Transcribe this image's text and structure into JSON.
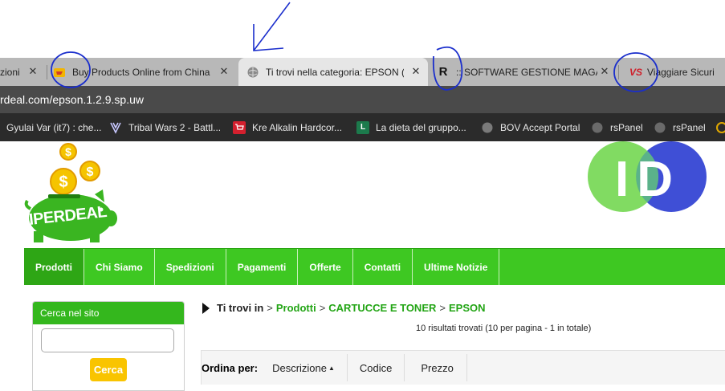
{
  "browser": {
    "tabs": [
      {
        "title": "zioni",
        "favicon": "none"
      },
      {
        "title": "Buy Products Online from China",
        "favicon": "shopping-icon"
      },
      {
        "title": "Ti trovi nella categoria: EPSON (P",
        "favicon": "globe-icon"
      },
      {
        "title": ":: SOFTWARE GESTIONE MAGAZZ",
        "favicon": "r-logo-icon",
        "favicon_text": "R"
      },
      {
        "title": "Viaggiare Sicuri",
        "favicon": "vs-logo-icon",
        "favicon_text": "VS"
      }
    ],
    "url": "rdeal.com/epson.1.2.9.sp.uw",
    "bookmarks": [
      {
        "label": "Gyulai Var (it7) : che...",
        "icon": "none"
      },
      {
        "label": "Tribal Wars 2 - Battl...",
        "icon": "tribal-wars-icon"
      },
      {
        "label": "Kre Alkalin Hardcor...",
        "icon": "cart-icon"
      },
      {
        "label": "La dieta del gruppo...",
        "icon": "l-logo-icon",
        "icon_text": "L"
      },
      {
        "label": "BOV Accept Portal",
        "icon": "globe-icon"
      },
      {
        "label": "rsPanel",
        "icon": "globe-icon"
      },
      {
        "label": "rsPanel",
        "icon": "globe-icon"
      }
    ]
  },
  "site": {
    "logo_text": "IPERDEAL",
    "logo_right_text": "ID",
    "nav": [
      "Prodotti",
      "Chi Siamo",
      "Spedizioni",
      "Pagamenti",
      "Offerte",
      "Contatti",
      "Ultime Notizie"
    ],
    "search": {
      "title": "Cerca nel sito",
      "button": "Cerca",
      "value": ""
    },
    "breadcrumb": {
      "intro": "Ti trovi in",
      "items": [
        "Prodotti",
        "CARTUCCE E TONER",
        "EPSON"
      ],
      "separator": ">"
    },
    "results_text": "10 risultati trovati (10 per pagina - 1 in totale)",
    "sort": {
      "label": "Ordina per:",
      "options": [
        "Descrizione",
        "Codice",
        "Prezzo"
      ],
      "active_arrow": "▲"
    }
  },
  "colors": {
    "nav_green": "#3ec822",
    "link_green": "#23a515",
    "annotation_blue": "#1a2ecc",
    "button_yellow": "#f9c400"
  }
}
